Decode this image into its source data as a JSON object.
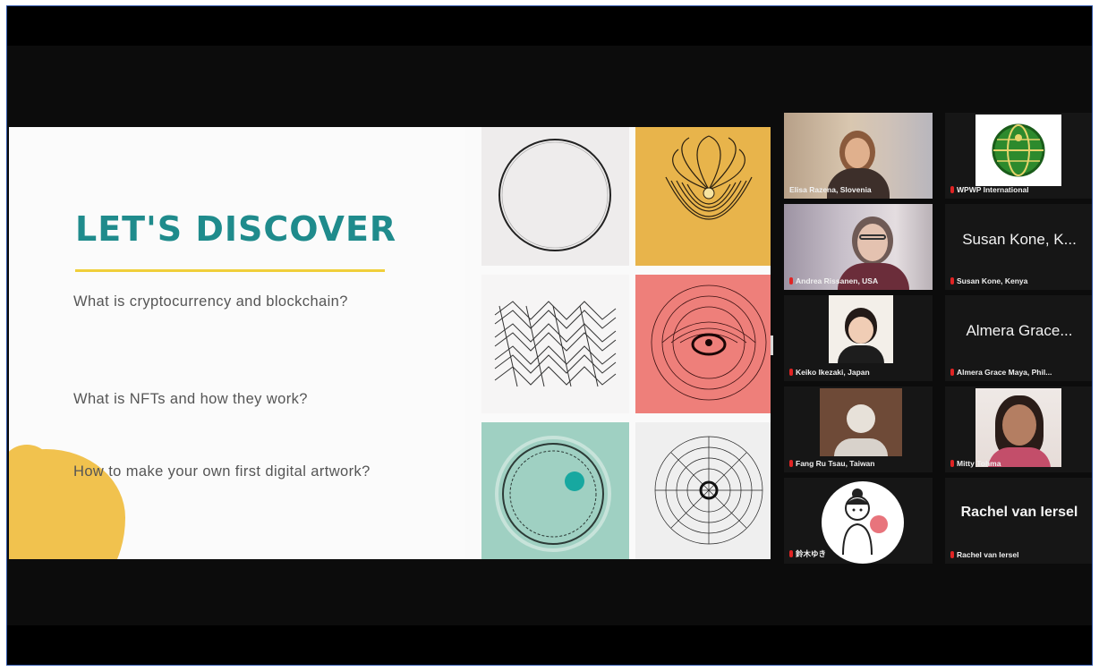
{
  "slide": {
    "title": "LET'S DISCOVER",
    "questions": [
      "What is cryptocurrency and blockchain?",
      "What is NFTs and how they work?",
      "How to make your own first digital artwork?"
    ]
  },
  "participants": [
    {
      "name": "Elisa Razena, Slovenia",
      "muted": false,
      "video": true,
      "active": true
    },
    {
      "name": "WPWP International",
      "muted": true,
      "video": true,
      "logo": "globe-logo"
    },
    {
      "name": "Andrea Rissanen, USA",
      "muted": true,
      "video": true
    },
    {
      "display": "Susan Kone, K...",
      "name": "Susan Kone, Kenya",
      "muted": true,
      "video": false
    },
    {
      "name": "Keiko Ikezaki, Japan",
      "muted": true,
      "video": true
    },
    {
      "display": "Almera Grace...",
      "name": "Almera Grace Maya, Phil...",
      "muted": true,
      "video": false
    },
    {
      "name": "Fang Ru Tsau, Taiwan",
      "muted": true,
      "video": true
    },
    {
      "name": "Mitty Tohma",
      "muted": true,
      "video": true
    },
    {
      "name": "鈴木ゆき",
      "muted": true,
      "video": true
    },
    {
      "display": "Rachel van Iersel",
      "name": "Rachel van Iersel",
      "muted": true,
      "video": false
    }
  ],
  "colors": {
    "title": "#1f8b8c",
    "accent_rule": "#f0cf3a",
    "blob": "#f1c24e",
    "active_speaker": "#2fa54a",
    "muted_mic": "#e02424"
  }
}
